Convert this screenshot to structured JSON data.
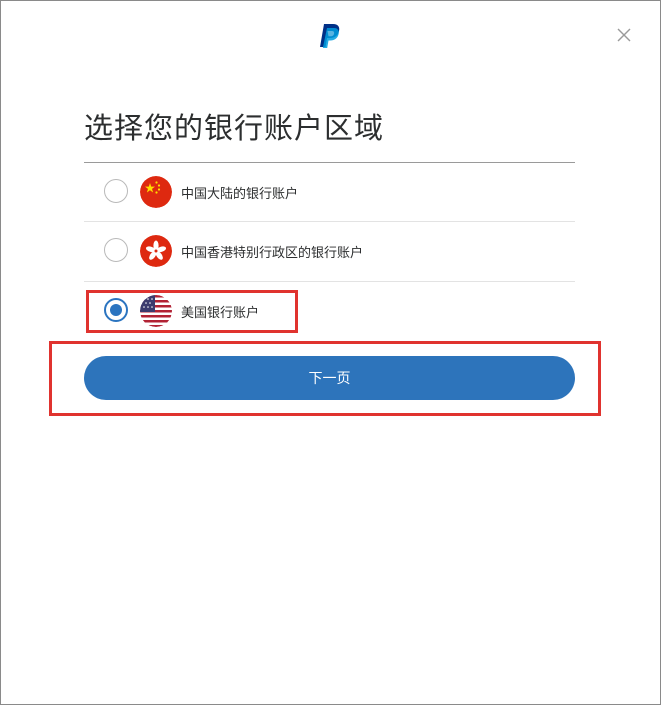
{
  "header": {
    "logo_icon": "paypal-logo-icon",
    "close_icon": "close-icon",
    "brand_color": "#003087",
    "brand_color_light": "#009cde"
  },
  "dialog": {
    "title": "选择您的银行账户区域",
    "options": [
      {
        "label": "中国大陆的银行账户",
        "flag_icon": "china-flag-icon",
        "selected": false
      },
      {
        "label": "中国香港特别行政区的银行账户",
        "flag_icon": "hong-kong-flag-icon",
        "selected": false
      },
      {
        "label": "美国银行账户",
        "flag_icon": "us-flag-icon",
        "selected": true
      }
    ],
    "next_button_label": "下一页",
    "accent_color": "#2d74bb",
    "highlight_color": "#e0332f"
  }
}
